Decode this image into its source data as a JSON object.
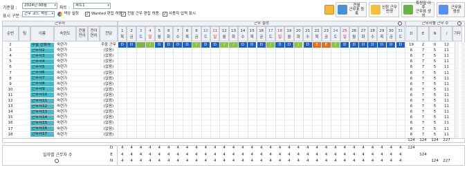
{
  "toolbar": {
    "base_month_label": "기준월 :",
    "base_month_value": "2024년 08월",
    "part_label": "파트 :",
    "part_value": "파트1",
    "display_label": "표시 구분 :",
    "display_value": "근무 코드 색상...",
    "color_settings_label": "색상 설정",
    "wanted_edit_label": "Wanted 편집 허용",
    "wanted_edit_checked": true,
    "full_edit_label": "전월 근무 편집 허용",
    "full_edit_checked": true,
    "user_input_label": "사용자 입력 표시",
    "user_input_checked": true,
    "btn_register_line1": "전월",
    "btn_register_line2": "근무표 등록",
    "btn_apply_line1": "신청 근무",
    "btn_apply_line2": "반영",
    "btn_create_line1": "특정일 이후",
    "btn_create_line2": "근무표 생성",
    "btn_generate_label": "근무표 생성"
  },
  "table": {
    "group_worker": "근무자",
    "group_setting": "근무 설정",
    "group_count": "근무자별 근무 수",
    "col_order": "순번",
    "col_team": "팀",
    "col_name": "이름",
    "col_grade": "숙련도",
    "col_full": "전월 전야",
    "col_next": "전야 연차",
    "col_fixed": "전담",
    "col_D": "D",
    "col_E": "E",
    "col_N": "N",
    "col_slash": "/",
    "col_other": "기타",
    "days": [
      "1",
      "2",
      "3",
      "4",
      "5",
      "6",
      "7",
      "8",
      "9",
      "10",
      "11",
      "12",
      "13",
      "14",
      "15",
      "16",
      "17",
      "18",
      "19",
      "20",
      "21",
      "22",
      "23",
      "24",
      "25",
      "26",
      "27",
      "28",
      "29",
      "30",
      "31"
    ],
    "weekdays": [
      "목",
      "금",
      "토",
      "일",
      "월",
      "화",
      "수",
      "목",
      "금",
      "토",
      "일",
      "월",
      "화",
      "수",
      "목",
      "금",
      "토",
      "일",
      "월",
      "화",
      "수",
      "목",
      "금",
      "토",
      "일",
      "월",
      "화",
      "수",
      "목",
      "금",
      "토"
    ],
    "rows": [
      {
        "order": "2",
        "name": "주말 간호사",
        "grade": "숙련가",
        "fixed": "주중 근무",
        "d": "19",
        "e": "2",
        "n": "0",
        "s": "12"
      },
      {
        "order": "3",
        "name": "근무자2",
        "grade": "숙련가",
        "fixed": "(없음)",
        "d": "6",
        "e": "7",
        "n": "5",
        "s": "11"
      },
      {
        "order": "4",
        "name": "근무자3",
        "grade": "숙련가",
        "fixed": "(없음)",
        "d": "6",
        "e": "7",
        "n": "5",
        "s": "11"
      },
      {
        "order": "5",
        "name": "근무자4",
        "grade": "숙련가",
        "fixed": "(없음)",
        "d": "6",
        "e": "7",
        "n": "5",
        "s": "11"
      },
      {
        "order": "6",
        "name": "근무자5",
        "grade": "숙련가",
        "fixed": "(없음)",
        "d": "6",
        "e": "7",
        "n": "5",
        "s": "11"
      },
      {
        "order": "7",
        "name": "근무자6",
        "grade": "숙련가",
        "fixed": "(없음)",
        "d": "6",
        "e": "7",
        "n": "5",
        "s": "11"
      },
      {
        "order": "8",
        "name": "근무자7",
        "grade": "숙련가",
        "fixed": "(없음)",
        "d": "6",
        "e": "7",
        "n": "5",
        "s": "11"
      },
      {
        "order": "9",
        "name": "근무자8",
        "grade": "숙련가",
        "fixed": "(없음)",
        "d": "6",
        "e": "7",
        "n": "5",
        "s": "11"
      },
      {
        "order": "10",
        "name": "근무자9",
        "grade": "숙련가",
        "fixed": "(없음)",
        "d": "6",
        "e": "7",
        "n": "5",
        "s": "11"
      },
      {
        "order": "11",
        "name": "근무자10",
        "grade": "숙련가",
        "fixed": "(없음)",
        "d": "6",
        "e": "7",
        "n": "5",
        "s": "11"
      },
      {
        "order": "12",
        "name": "근무자11",
        "grade": "숙련가",
        "fixed": "(없음)",
        "d": "6",
        "e": "7",
        "n": "5",
        "s": "11"
      },
      {
        "order": "13",
        "name": "근무자12",
        "grade": "숙련가",
        "fixed": "(없음)",
        "d": "6",
        "e": "7",
        "n": "5",
        "s": "11"
      },
      {
        "order": "14",
        "name": "근무자13",
        "grade": "숙련가",
        "fixed": "(없음)",
        "d": "6",
        "e": "7",
        "n": "5",
        "s": "11"
      },
      {
        "order": "15",
        "name": "근무자14",
        "grade": "숙련가",
        "fixed": "(없음)",
        "d": "6",
        "e": "7",
        "n": "5",
        "s": "11"
      },
      {
        "order": "16",
        "name": "근무자15",
        "grade": "숙련가",
        "fixed": "(없음)",
        "d": "6",
        "e": "7",
        "n": "5",
        "s": "11"
      },
      {
        "order": "17",
        "name": "근무자16",
        "grade": "숙련가",
        "fixed": "(없음)",
        "d": "6",
        "e": "7",
        "n": "5",
        "s": "11"
      },
      {
        "order": "18",
        "name": "근무자17",
        "grade": "숙련가",
        "fixed": "(없음)",
        "d": "6",
        "e": "7",
        "n": "5",
        "s": "11"
      }
    ],
    "first_row_schedule": [
      "D",
      "D",
      "",
      "/",
      "D",
      "D",
      "D",
      "D",
      "/",
      "D",
      "D",
      "/",
      "/",
      "D",
      "D",
      "D",
      "/",
      "D",
      "D",
      "/",
      "D",
      "E",
      "E",
      "/",
      "D",
      "D",
      "D",
      "D",
      "D",
      "D",
      "D"
    ],
    "totals": {
      "d": "124",
      "e": "124",
      "n": "124",
      "s": "227"
    }
  },
  "daily": {
    "label": "일자별 근무자 수",
    "row_labels": [
      "D",
      "E",
      "N"
    ],
    "d_values": [
      "4",
      "4",
      "4",
      "4",
      "4",
      "4",
      "4",
      "4",
      "4",
      "4",
      "4",
      "4",
      "4",
      "4",
      "4",
      "4",
      "4",
      "4",
      "4",
      "4",
      "4",
      "4",
      "4",
      "4",
      "4",
      "4",
      "4",
      "4",
      "4",
      "4",
      "4"
    ],
    "e_values": [
      "4",
      "4",
      "4",
      "4",
      "4",
      "4",
      "4",
      "4",
      "4",
      "4",
      "4",
      "4",
      "4",
      "4",
      "4",
      "4",
      "4",
      "4",
      "4",
      "4",
      "4",
      "4",
      "4",
      "4",
      "4",
      "4",
      "4",
      "4",
      "4",
      "4",
      "4"
    ],
    "n_values": [
      "4",
      "4",
      "4",
      "4",
      "4",
      "4",
      "4",
      "4",
      "4",
      "4",
      "4",
      "4",
      "4",
      "4",
      "4",
      "4",
      "4",
      "4",
      "4",
      "4",
      "4",
      "4",
      "4",
      "4",
      "4",
      "4",
      "4",
      "4",
      "4",
      "4",
      "4"
    ],
    "d_total": "124",
    "e_total": "124",
    "n_total": "124",
    "n_total2": "227"
  },
  "colors": {
    "D": "#1f5fbf",
    "E": "#e07020",
    "slash": "#8bc34a",
    "name_bg": "#4db8c8",
    "saturday": "#2a6fd6",
    "sunday": "#d62a2a"
  }
}
